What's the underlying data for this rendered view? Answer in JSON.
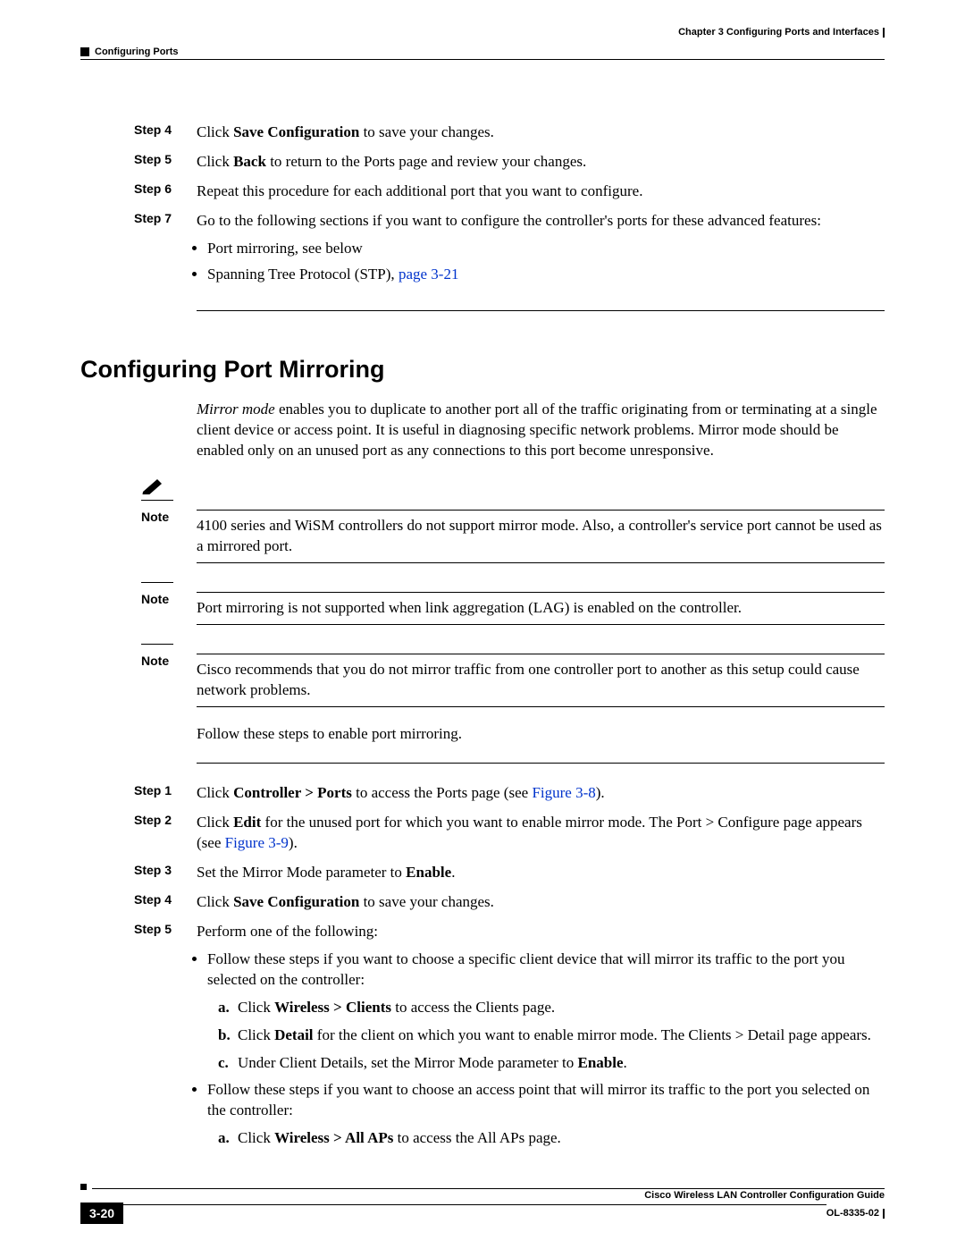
{
  "header": {
    "chapter": "Chapter 3    Configuring Ports and Interfaces",
    "section": "Configuring Ports"
  },
  "stepsTop": [
    {
      "label": "Step 4",
      "prefix": "Click ",
      "bold": "Save Configuration",
      "suffix": " to save your changes."
    },
    {
      "label": "Step 5",
      "prefix": "Click ",
      "bold": "Back",
      "suffix": " to return to the Ports page and review your changes."
    },
    {
      "label": "Step 6",
      "plain": "Repeat this procedure for each additional port that you want to configure."
    },
    {
      "label": "Step 7",
      "plain": "Go to the following sections if you want to configure the controller's ports for these advanced features:"
    }
  ],
  "step7Bullets": {
    "b1": "Port mirroring, see below",
    "b2a": "Spanning Tree Protocol (STP), ",
    "b2link": "page 3-21"
  },
  "sectionTitle": "Configuring Port Mirroring",
  "intro": {
    "italic": "Mirror mode",
    "rest": " enables you to duplicate to another port all of the traffic originating from or terminating at a single client device or access point. It is useful in diagnosing specific network problems. Mirror mode should be enabled only on an unused port as any connections to this port become unresponsive."
  },
  "notes": {
    "label": "Note",
    "n1": "4100 series and WiSM controllers do not support mirror mode. Also, a controller's service port cannot be used as a mirrored port.",
    "n2": "Port mirroring is not supported when link aggregation (LAG) is enabled on the controller.",
    "n3": "Cisco recommends that you do not mirror traffic from one controller port to another as this setup could cause network problems."
  },
  "follow": "Follow these steps to enable port mirroring.",
  "stepsBottom": {
    "s1": {
      "label": "Step 1",
      "a": "Click ",
      "b": "Controller > Ports",
      "c": " to access the Ports page (see ",
      "link": "Figure 3-8",
      "d": ")."
    },
    "s2": {
      "label": "Step 2",
      "a": "Click ",
      "b": "Edit",
      "c": " for the unused port for which you want to enable mirror mode. The Port > Configure page appears (see ",
      "link": "Figure 3-9",
      "d": ")."
    },
    "s3": {
      "label": "Step 3",
      "a": "Set the Mirror Mode parameter to ",
      "b": "Enable",
      "c": "."
    },
    "s4": {
      "label": "Step 4",
      "a": "Click ",
      "b": "Save Configuration",
      "c": " to save your changes."
    },
    "s5": {
      "label": "Step 5",
      "a": "Perform one of the following:"
    }
  },
  "s5Bullets": {
    "b1": "Follow these steps if you want to choose a specific client device that will mirror its traffic to the port you selected on the controller:",
    "b1a": {
      "let": "a.",
      "a": "Click ",
      "b": "Wireless > Clients",
      "c": " to access the Clients page."
    },
    "b1b": {
      "let": "b.",
      "a": "Click ",
      "b": "Detail",
      "c": " for the client on which you want to enable mirror mode. The Clients > Detail page appears."
    },
    "b1c": {
      "let": "c.",
      "a": "Under Client Details, set the Mirror Mode parameter to ",
      "b": "Enable",
      "c": "."
    },
    "b2": "Follow these steps if you want to choose an access point that will mirror its traffic to the port you selected on the controller:",
    "b2a": {
      "let": "a.",
      "a": "Click ",
      "b": "Wireless > All APs",
      "c": " to access the All APs page."
    }
  },
  "footer": {
    "guide": "Cisco Wireless LAN Controller Configuration Guide",
    "page": "3-20",
    "doc": "OL-8335-02"
  }
}
